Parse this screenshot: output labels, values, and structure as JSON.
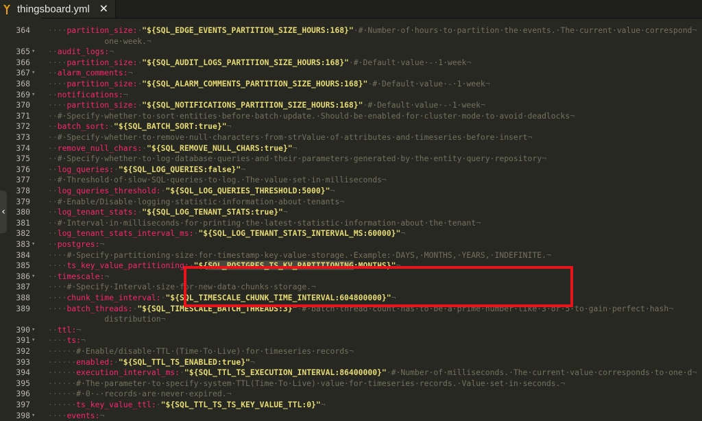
{
  "tab": {
    "filename": "thingsboard.yml",
    "close_glyph": "✕"
  },
  "colors": {
    "key": "#f92672",
    "string": "#e6db74",
    "comment": "#75715e",
    "whitespace": "#5a5b53",
    "background": "#272822",
    "highlight_box": "#e8141c"
  },
  "lines": [
    {
      "n": "364",
      "fold": "",
      "indent": "····",
      "parts": [
        {
          "t": "k",
          "v": "partition_size:"
        },
        {
          "t": "s",
          "v": "\"${SQL_EDGE_EVENTS_PARTITION_SIZE_HOURS:168}\""
        },
        {
          "t": "c",
          "v": "#·Number·of·hours·to·partition·the·events.·The·current·value·correspond"
        }
      ]
    },
    {
      "n": "",
      "fold": "",
      "indent": "",
      "parts": [
        {
          "t": "c",
          "v": "            one·week."
        }
      ]
    },
    {
      "n": "365",
      "fold": "▾",
      "indent": "··",
      "parts": [
        {
          "t": "k",
          "v": "audit_logs:"
        }
      ]
    },
    {
      "n": "366",
      "fold": "",
      "indent": "····",
      "parts": [
        {
          "t": "k",
          "v": "partition_size:"
        },
        {
          "t": "s",
          "v": "\"${SQL_AUDIT_LOGS_PARTITION_SIZE_HOURS:168}\""
        },
        {
          "t": "c",
          "v": "#·Default·value·-·1·week"
        }
      ]
    },
    {
      "n": "367",
      "fold": "▾",
      "indent": "··",
      "parts": [
        {
          "t": "k",
          "v": "alarm_comments:"
        }
      ]
    },
    {
      "n": "368",
      "fold": "",
      "indent": "····",
      "parts": [
        {
          "t": "k",
          "v": "partition_size:"
        },
        {
          "t": "s",
          "v": "\"${SQL_ALARM_COMMENTS_PARTITION_SIZE_HOURS:168}\""
        },
        {
          "t": "c",
          "v": "#·Default·value·-·1·week"
        }
      ]
    },
    {
      "n": "369",
      "fold": "▾",
      "indent": "··",
      "parts": [
        {
          "t": "k",
          "v": "notifications:"
        }
      ]
    },
    {
      "n": "370",
      "fold": "",
      "indent": "····",
      "parts": [
        {
          "t": "k",
          "v": "partition_size:"
        },
        {
          "t": "s",
          "v": "\"${SQL_NOTIFICATIONS_PARTITION_SIZE_HOURS:168}\""
        },
        {
          "t": "c",
          "v": "#·Default·value·-·1·week"
        }
      ]
    },
    {
      "n": "371",
      "fold": "",
      "indent": "··",
      "parts": [
        {
          "t": "c",
          "v": "#·Specify·whether·to·sort·entities·before·batch·update.·Should·be·enabled·for·cluster·mode·to·avoid·deadlocks"
        }
      ]
    },
    {
      "n": "372",
      "fold": "",
      "indent": "··",
      "parts": [
        {
          "t": "k",
          "v": "batch_sort:"
        },
        {
          "t": "s",
          "v": "\"${SQL_BATCH_SORT:true}\""
        }
      ]
    },
    {
      "n": "373",
      "fold": "",
      "indent": "··",
      "parts": [
        {
          "t": "c",
          "v": "#·Specify·whether·to·remove·null·characters·from·strValue·of·attributes·and·timeseries·before·insert"
        }
      ]
    },
    {
      "n": "374",
      "fold": "",
      "indent": "··",
      "parts": [
        {
          "t": "k",
          "v": "remove_null_chars:"
        },
        {
          "t": "s",
          "v": "\"${SQL_REMOVE_NULL_CHARS:true}\""
        }
      ]
    },
    {
      "n": "375",
      "fold": "",
      "indent": "··",
      "parts": [
        {
          "t": "c",
          "v": "#·Specify·whether·to·log·database·queries·and·their·parameters·generated·by·the·entity·query·repository"
        }
      ]
    },
    {
      "n": "376",
      "fold": "",
      "indent": "··",
      "parts": [
        {
          "t": "k",
          "v": "log_queries:"
        },
        {
          "t": "s",
          "v": "\"${SQL_LOG_QUERIES:false}\""
        }
      ]
    },
    {
      "n": "377",
      "fold": "",
      "indent": "··",
      "parts": [
        {
          "t": "c",
          "v": "#·Threshold·of·slow·SQL·queries·to·log.·The·value·set·in·milliseconds"
        }
      ]
    },
    {
      "n": "378",
      "fold": "",
      "indent": "··",
      "parts": [
        {
          "t": "k",
          "v": "log_queries_threshold:"
        },
        {
          "t": "s",
          "v": "\"${SQL_LOG_QUERIES_THRESHOLD:5000}\""
        }
      ]
    },
    {
      "n": "379",
      "fold": "",
      "indent": "··",
      "parts": [
        {
          "t": "c",
          "v": "#·Enable/Disable·logging·statistic·information·about·tenants"
        }
      ]
    },
    {
      "n": "380",
      "fold": "",
      "indent": "··",
      "parts": [
        {
          "t": "k",
          "v": "log_tenant_stats:"
        },
        {
          "t": "s",
          "v": "\"${SQL_LOG_TENANT_STATS:true}\""
        }
      ]
    },
    {
      "n": "381",
      "fold": "",
      "indent": "··",
      "parts": [
        {
          "t": "c",
          "v": "#·Interval·in·milliseconds·for·printing·the·latest·statistic·information·about·the·tenant"
        }
      ]
    },
    {
      "n": "382",
      "fold": "",
      "indent": "··",
      "parts": [
        {
          "t": "k",
          "v": "log_tenant_stats_interval_ms:"
        },
        {
          "t": "s",
          "v": "\"${SQL_LOG_TENANT_STATS_INTERVAL_MS:60000}\""
        }
      ]
    },
    {
      "n": "383",
      "fold": "▾",
      "indent": "··",
      "parts": [
        {
          "t": "k",
          "v": "postgres:"
        }
      ]
    },
    {
      "n": "384",
      "fold": "",
      "indent": "····",
      "parts": [
        {
          "t": "c",
          "v": "#·Specify·partitioning·size·for·timestamp·key-value·storage.·Example:·DAYS,·MONTHS,·YEARS,·INDEFINITE."
        }
      ]
    },
    {
      "n": "385",
      "fold": "",
      "indent": "····",
      "parts": [
        {
          "t": "k",
          "v": "ts_key_value_partitioning:"
        },
        {
          "t": "s",
          "v": "\"${"
        },
        {
          "t": "sel",
          "v": "SQL_POSTGRES_TS_KV_PARTITIONING"
        },
        {
          "t": "s",
          "v": ":MONTHS}\""
        }
      ]
    },
    {
      "n": "386",
      "fold": "▾",
      "indent": "··",
      "parts": [
        {
          "t": "k",
          "v": "timescale:"
        }
      ]
    },
    {
      "n": "387",
      "fold": "",
      "indent": "····",
      "parts": [
        {
          "t": "c",
          "v": "#·Specify·Interval·size·for·new·data·chunks·storage."
        }
      ]
    },
    {
      "n": "388",
      "fold": "",
      "indent": "····",
      "parts": [
        {
          "t": "k",
          "v": "chunk_time_interval:"
        },
        {
          "t": "s",
          "v": "\"${SQL_TIMESCALE_CHUNK_TIME_INTERVAL:604800000}\""
        }
      ]
    },
    {
      "n": "389",
      "fold": "",
      "indent": "····",
      "parts": [
        {
          "t": "k",
          "v": "batch_threads:"
        },
        {
          "t": "s",
          "v": "\"${SQL_TIMESCALE_BATCH_THREADS:3}\""
        },
        {
          "t": "c",
          "v": "#·batch·thread·count·has·to·be·a·prime·number·like·3·or·5·to·gain·perfect·hash"
        }
      ]
    },
    {
      "n": "",
      "fold": "",
      "indent": "",
      "parts": [
        {
          "t": "c",
          "v": "            distribution"
        }
      ]
    },
    {
      "n": "390",
      "fold": "▾",
      "indent": "··",
      "parts": [
        {
          "t": "k",
          "v": "ttl:"
        }
      ]
    },
    {
      "n": "391",
      "fold": "▾",
      "indent": "····",
      "parts": [
        {
          "t": "k",
          "v": "ts:"
        }
      ]
    },
    {
      "n": "392",
      "fold": "",
      "indent": "······",
      "parts": [
        {
          "t": "c",
          "v": "#·Enable/disable·TTL·(Time·To·Live)·for·timeseries·records"
        }
      ]
    },
    {
      "n": "393",
      "fold": "",
      "indent": "······",
      "parts": [
        {
          "t": "k",
          "v": "enabled:"
        },
        {
          "t": "s",
          "v": "\"${SQL_TTL_TS_ENABLED:true}\""
        }
      ]
    },
    {
      "n": "394",
      "fold": "",
      "indent": "······",
      "parts": [
        {
          "t": "k",
          "v": "execution_interval_ms:"
        },
        {
          "t": "s",
          "v": "\"${SQL_TTL_TS_EXECUTION_INTERVAL:86400000}\""
        },
        {
          "t": "c",
          "v": "#·Number·of·milliseconds.·The·current·value·corresponds·to·one·d"
        }
      ]
    },
    {
      "n": "395",
      "fold": "",
      "indent": "······",
      "parts": [
        {
          "t": "c",
          "v": "#·The·parameter·to·specify·system·TTL(Time·To·Live)·value·for·timeseries·records.·Value·set·in·seconds."
        }
      ]
    },
    {
      "n": "396",
      "fold": "",
      "indent": "······",
      "parts": [
        {
          "t": "c",
          "v": "#·0·-·records·are·never·expired."
        }
      ]
    },
    {
      "n": "397",
      "fold": "",
      "indent": "······",
      "parts": [
        {
          "t": "k",
          "v": "ts_key_value_ttl:"
        },
        {
          "t": "s",
          "v": "\"${SQL_TTL_TS_TS_KEY_VALUE_TTL:0}\""
        }
      ]
    },
    {
      "n": "398",
      "fold": "▾",
      "indent": "····",
      "parts": [
        {
          "t": "k",
          "v": "events:"
        }
      ]
    }
  ]
}
